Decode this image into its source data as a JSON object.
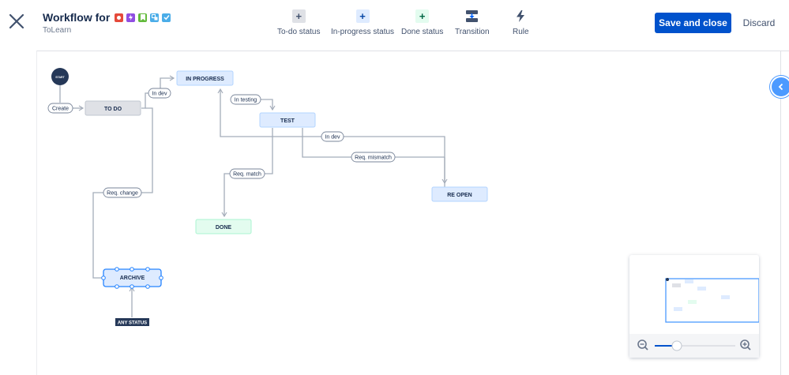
{
  "header": {
    "title": "Workflow for",
    "project": "ToLearn",
    "issue_type_icons": [
      {
        "name": "bug-icon",
        "color": "#e5493a"
      },
      {
        "name": "epic-icon",
        "color": "#904ee2"
      },
      {
        "name": "story-icon",
        "color": "#63ba3c"
      },
      {
        "name": "subtask-icon",
        "color": "#4bade8"
      },
      {
        "name": "task-icon",
        "color": "#4bade8"
      }
    ]
  },
  "toolbar": {
    "todo_status": "To-do status",
    "inprogress_status": "In-progress status",
    "done_status": "Done status",
    "transition": "Transition",
    "rule": "Rule"
  },
  "actions": {
    "save_label": "Save and close",
    "discard_label": "Discard"
  },
  "diagram": {
    "start_label": "START",
    "any_status_label": "ANY STATUS",
    "statuses": {
      "todo": "TO DO",
      "inprogress": "IN PROGRESS",
      "test": "TEST",
      "reopen": "RE OPEN",
      "done": "DONE",
      "archive": "ARCHIVE"
    },
    "transitions": {
      "create": "Create",
      "in_dev_1": "In dev",
      "in_testing": "In testing",
      "in_dev_2": "In dev",
      "req_mismatch": "Req. mismatch",
      "req_match": "Req. match",
      "req_change": "Req. change"
    }
  },
  "colors": {
    "accent": "#0052cc",
    "todo_fill": "#dfe1e6",
    "inprogress_fill": "#deebff",
    "done_fill": "#e3fcef",
    "line": "#a5adba"
  }
}
